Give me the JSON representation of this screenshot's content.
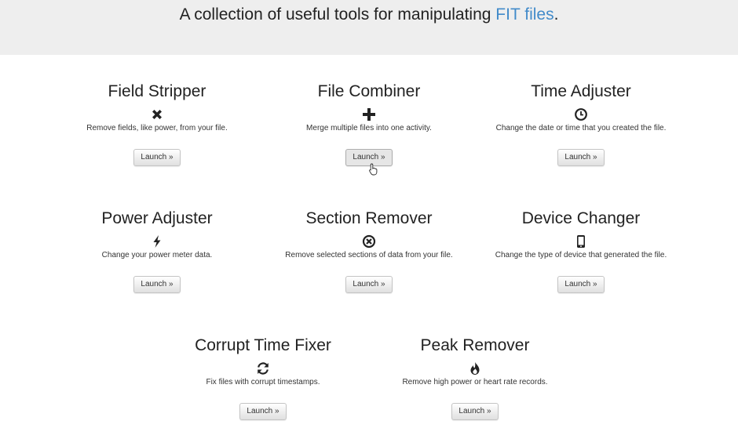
{
  "hero": {
    "text_prefix": "A collection of useful tools for manipulating ",
    "link_text": "FIT files",
    "text_suffix": ".",
    "link_color": "#428bca",
    "background": "#eeeeee"
  },
  "tools": [
    {
      "title": "Field Stripper",
      "icon": "times-icon",
      "description": "Remove fields, like power, from your file.",
      "button": "Launch »"
    },
    {
      "title": "File Combiner",
      "icon": "plus-icon",
      "description": "Merge multiple files into one activity.",
      "button": "Launch »"
    },
    {
      "title": "Time Adjuster",
      "icon": "clock-icon",
      "description": "Change the date or time that you created the file.",
      "button": "Launch »"
    },
    {
      "title": "Power Adjuster",
      "icon": "flash-icon",
      "description": "Change your power meter data.",
      "button": "Launch »"
    },
    {
      "title": "Section Remover",
      "icon": "remove-circle-icon",
      "description": "Remove selected sections of data from your file.",
      "button": "Launch »"
    },
    {
      "title": "Device Changer",
      "icon": "phone-icon",
      "description": "Change the type of device that generated the file.",
      "button": "Launch »"
    },
    {
      "title": "Corrupt Time Fixer",
      "icon": "refresh-icon",
      "description": "Fix files with corrupt timestamps.",
      "button": "Launch »"
    },
    {
      "title": "Peak Remover",
      "icon": "fire-icon",
      "description": "Remove high power or heart rate records.",
      "button": "Launch »"
    }
  ]
}
